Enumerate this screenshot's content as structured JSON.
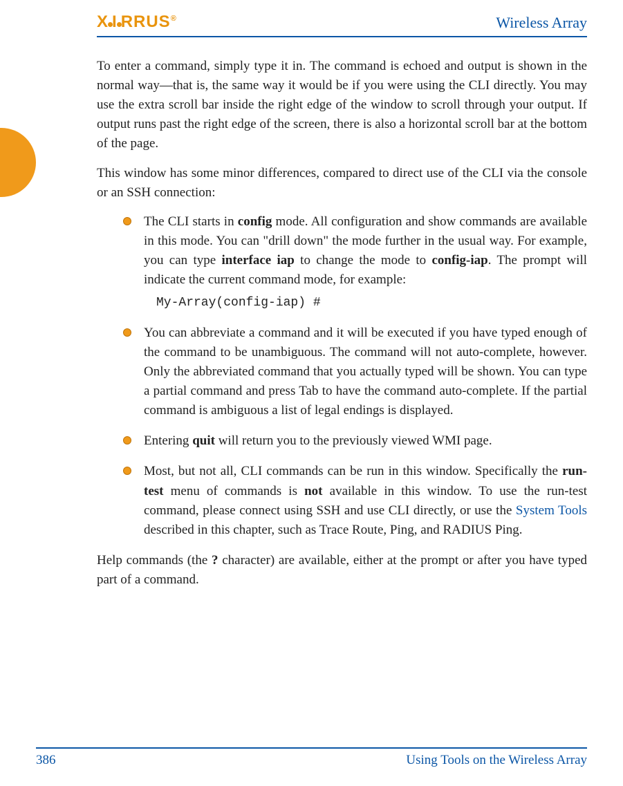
{
  "header": {
    "logo_text": "XIRRUS",
    "product_title": "Wireless Array"
  },
  "body": {
    "p1": "To enter a command, simply type it in. The command is echoed and output is shown in the normal way—that is, the same way it would be if you were using the CLI directly. You may use the extra scroll bar inside the right edge of the window to scroll through your output. If output runs past the right edge of the screen, there is also a horizontal scroll bar at the bottom of the page.",
    "p2": "This window has some minor differences, compared to direct use of the CLI via the console or an SSH connection:",
    "li1_a": "The CLI starts in ",
    "li1_b": "config",
    "li1_c": " mode. All configuration and show commands are available in this mode. You can \"drill down\" the mode further in the usual way. For example, you can type ",
    "li1_d": "interface iap",
    "li1_e": " to change the mode to ",
    "li1_f": "config-iap",
    "li1_g": ". The prompt will indicate the current command mode, for example:",
    "li1_code": "My-Array(config-iap) #",
    "li2": "You can abbreviate a command and it will be executed if you have typed enough of the command to be unambiguous. The command will not auto-complete, however. Only the abbreviated command that you actually typed will be shown. You can type a partial command and press Tab to have the command auto-complete. If the partial command is ambiguous a list of legal endings is displayed.",
    "li3_a": "Entering ",
    "li3_b": "quit",
    "li3_c": " will return you to the previously viewed WMI page.",
    "li4_a": "Most, but not all, CLI commands can be run in this window. Specifically the ",
    "li4_b": "run-test",
    "li4_c": " menu of commands is ",
    "li4_d": "not",
    "li4_e": " available in this window. To use the run-test command, please connect using SSH and use CLI directly, or use the ",
    "li4_link": "System Tools",
    "li4_f": " described in this chapter, such as Trace Route, Ping, and RADIUS Ping.",
    "p3_a": "Help commands (the ",
    "p3_b": "?",
    "p3_c": " character) are available, either at the prompt or after you have typed part of a command."
  },
  "footer": {
    "page_number": "386",
    "section": "Using Tools on the Wireless Array"
  }
}
